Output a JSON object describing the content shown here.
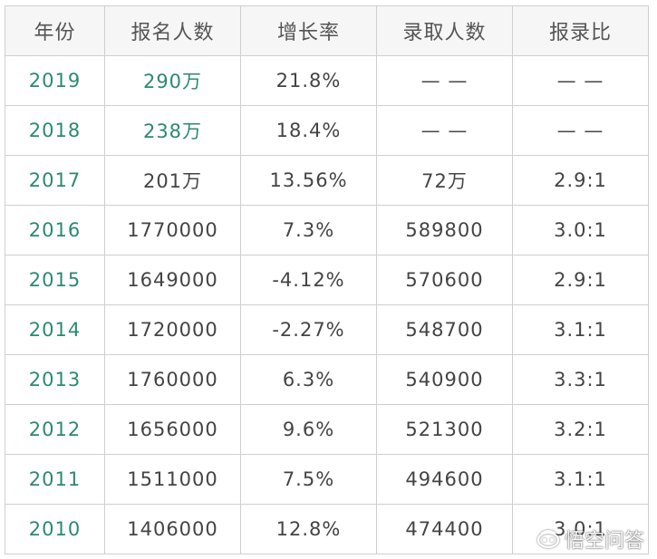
{
  "table": {
    "headers": [
      "年份",
      "报名人数",
      "增长率",
      "录取人数",
      "报录比"
    ],
    "rows": [
      {
        "year": "2019",
        "applicants": "290万",
        "growth": "21.8%",
        "admitted": "— —",
        "ratio": "— —",
        "highlight": true
      },
      {
        "year": "2018",
        "applicants": "238万",
        "growth": "18.4%",
        "admitted": "— —",
        "ratio": "— —",
        "highlight": true
      },
      {
        "year": "2017",
        "applicants": "201万",
        "growth": "13.56%",
        "admitted": "72万",
        "ratio": "2.9:1",
        "highlight": false
      },
      {
        "year": "2016",
        "applicants": "1770000",
        "growth": "7.3%",
        "admitted": "589800",
        "ratio": "3.0:1",
        "highlight": false
      },
      {
        "year": "2015",
        "applicants": "1649000",
        "growth": "-4.12%",
        "admitted": "570600",
        "ratio": "2.9:1",
        "highlight": false
      },
      {
        "year": "2014",
        "applicants": "1720000",
        "growth": "-2.27%",
        "admitted": "548700",
        "ratio": "3.1:1",
        "highlight": false
      },
      {
        "year": "2013",
        "applicants": "1760000",
        "growth": "6.3%",
        "admitted": "540900",
        "ratio": "3.3:1",
        "highlight": false
      },
      {
        "year": "2012",
        "applicants": "1656000",
        "growth": "9.6%",
        "admitted": "521300",
        "ratio": "3.2:1",
        "highlight": false
      },
      {
        "year": "2011",
        "applicants": "1511000",
        "growth": "7.5%",
        "admitted": "494600",
        "ratio": "3.1:1",
        "highlight": false
      },
      {
        "year": "2010",
        "applicants": "1406000",
        "growth": "12.8%",
        "admitted": "474400",
        "ratio": "3.0:1",
        "highlight": false
      }
    ]
  },
  "watermark": {
    "text": "悟空问答",
    "icon": "wukong-logo-icon"
  },
  "colors": {
    "year_text": "#2b8a6e",
    "header_bg": "#f6f6f6",
    "border": "#cfcfcf",
    "body_text": "#444444"
  }
}
